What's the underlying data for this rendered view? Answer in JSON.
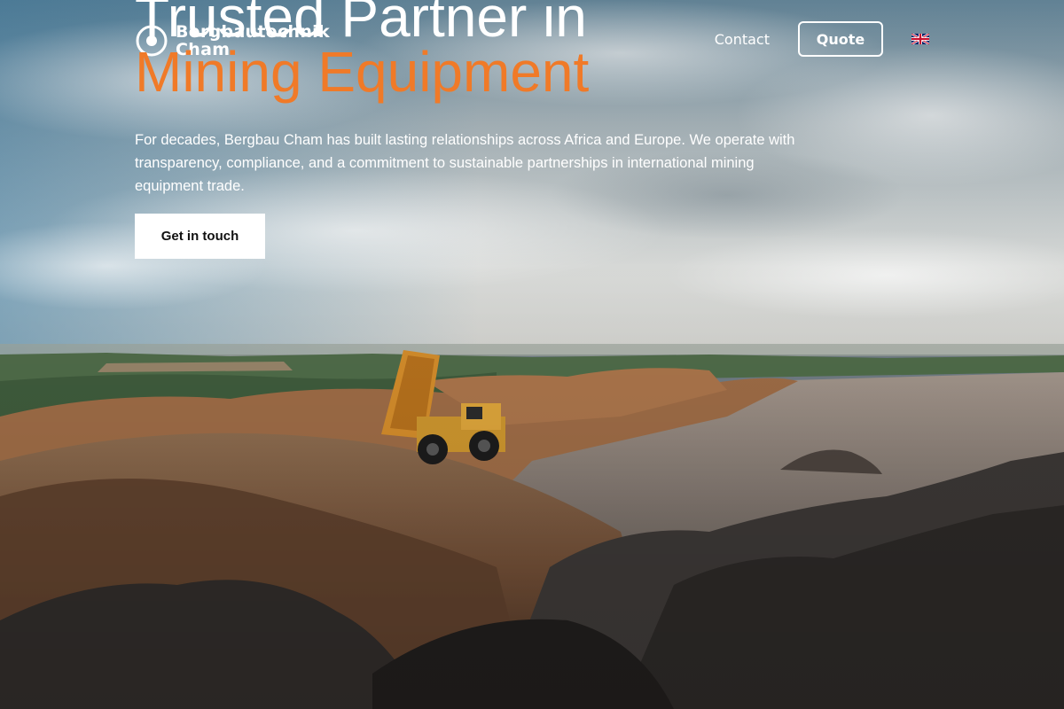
{
  "brand": {
    "name_line1": "Bergbautechnik",
    "name_line2": "Cham"
  },
  "nav": {
    "contact_label": "Contact",
    "quote_label": "Quote",
    "language_icon": "uk-flag-icon"
  },
  "hero": {
    "headline_line1": "Trusted Partner in",
    "headline_line2": "Mining Equipment",
    "lead": "For decades, Bergbau Cham has built lasting relationships across Africa and Europe. We operate with transparency, compliance, and a commitment to sustainable partnerships in international mining equipment trade.",
    "cta_label": "Get in touch"
  },
  "colors": {
    "accent": "#f07a28",
    "text": "#ffffff",
    "button_bg": "#ffffff",
    "button_text": "#111111"
  }
}
